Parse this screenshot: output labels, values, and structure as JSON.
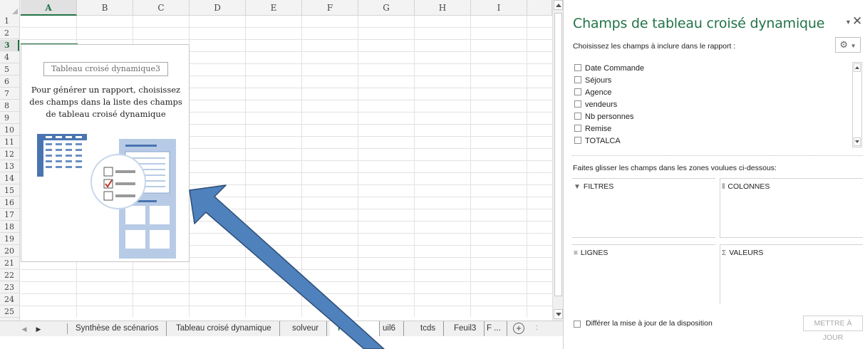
{
  "spreadsheet": {
    "columns": [
      "A",
      "B",
      "C",
      "D",
      "E",
      "F",
      "G",
      "H",
      "I"
    ],
    "selected_column": "A",
    "rows": [
      "1",
      "2",
      "3",
      "4",
      "5",
      "6",
      "7",
      "8",
      "9",
      "10",
      "11",
      "12",
      "13",
      "14",
      "15",
      "16",
      "17",
      "18",
      "19",
      "20",
      "21",
      "22",
      "23",
      "24",
      "25"
    ],
    "selected_row": "3"
  },
  "pivot_placeholder": {
    "title": "Tableau croisé dynamique3",
    "message": "Pour générer un rapport, choisissez des champs dans la liste des champs de tableau croisé dynamique"
  },
  "sheet_tabs": {
    "tabs": [
      "Synthèse de scénarios",
      "Tableau croisé dynamique",
      "solveur",
      "Fe",
      "uil6",
      "tcds",
      "Feuil3",
      "F ..."
    ],
    "active": "Fe",
    "add_sheet_symbol": "+",
    "more_symbol": ":"
  },
  "field_pane": {
    "title": "Champs de tableau croisé dynamique",
    "subtitle": "Choisissez les champs à inclure dans le rapport :",
    "fields": [
      "Date Commande",
      "Séjours",
      "Agence",
      "vendeurs",
      "Nb personnes",
      "Remise",
      "TOTALCA"
    ],
    "drag_instruction": "Faites glisser les champs dans les zones voulues ci-dessous:",
    "zones": {
      "filters": "FILTRES",
      "columns": "COLONNES",
      "rows": "LIGNES",
      "values": "VALEURS"
    },
    "defer_label": "Différer la mise à jour de la disposition",
    "update_button": "METTRE À JOUR",
    "accent_color": "#217346",
    "icons": [
      "filter-icon",
      "columns-icon",
      "rows-icon",
      "sigma-icon",
      "gear-icon",
      "close-icon"
    ]
  },
  "overlay": {
    "arrow_color": "#4f81bd",
    "arrow_outline": "#2c4d75"
  }
}
